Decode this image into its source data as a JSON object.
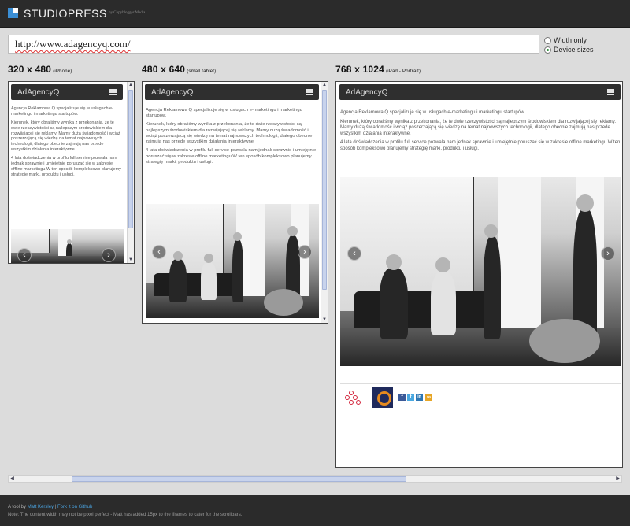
{
  "header": {
    "brand": "STUDIOPRESS",
    "byline": "by Copyblogger Media",
    "logo_colors": [
      "#3b8fd6",
      "#ffffff",
      "#3b8fd6",
      "#3b8fd6"
    ]
  },
  "url_bar": {
    "value": "http://www.adagencyq.com/"
  },
  "view_options": [
    {
      "label": "Width only",
      "selected": false
    },
    {
      "label": "Device sizes",
      "selected": true
    }
  ],
  "devices": [
    {
      "size": "320 x 480",
      "name": "(iPhone)"
    },
    {
      "size": "480 x 640",
      "name": "(small tablet)"
    },
    {
      "size": "768 x 1024",
      "name": "(iPad - Portrait)"
    }
  ],
  "site": {
    "brand": "AdAgencyQ",
    "para1": "Agencja Reklamowa Q specjalizuje się w usługach e-marketingu i marketingu startupów.",
    "para2": "Kierunek, który obraliśmy wynika z przekonania, że te dwie rzeczywistości są najlepszym środowiskiem dla rozwijającej się reklamy. Mamy dużą świadomość i wciąż poszerzającą się wiedzę na temat najnowszych technologii, dlatego obecnie zajmują nas przede wszystkim działania interaktywne.",
    "para3": "4 lata doświadczenia w profilu full service pozwala nam jednak sprawnie i umiejętnie poruszać się w zakresie offline marketingu.W ten sposób kompleksowo planujemy strategię marki, produktu i usługi.",
    "prev_icon": "chevron-left-icon",
    "next_icon": "chevron-right-icon",
    "social": [
      "f",
      "t",
      "in",
      "rss"
    ],
    "social_colors": [
      "#3b5998",
      "#4aa8e0",
      "#2e77b4",
      "#e6a526"
    ]
  },
  "footer": {
    "prefix": "A tool by",
    "author": "Matt Kersley",
    "separator": "|",
    "fork": "Fork it on Github",
    "note": "Note: The content width may not be pixel perfect - Matt has added 15px to the iframes to cater for the scrollbars."
  }
}
